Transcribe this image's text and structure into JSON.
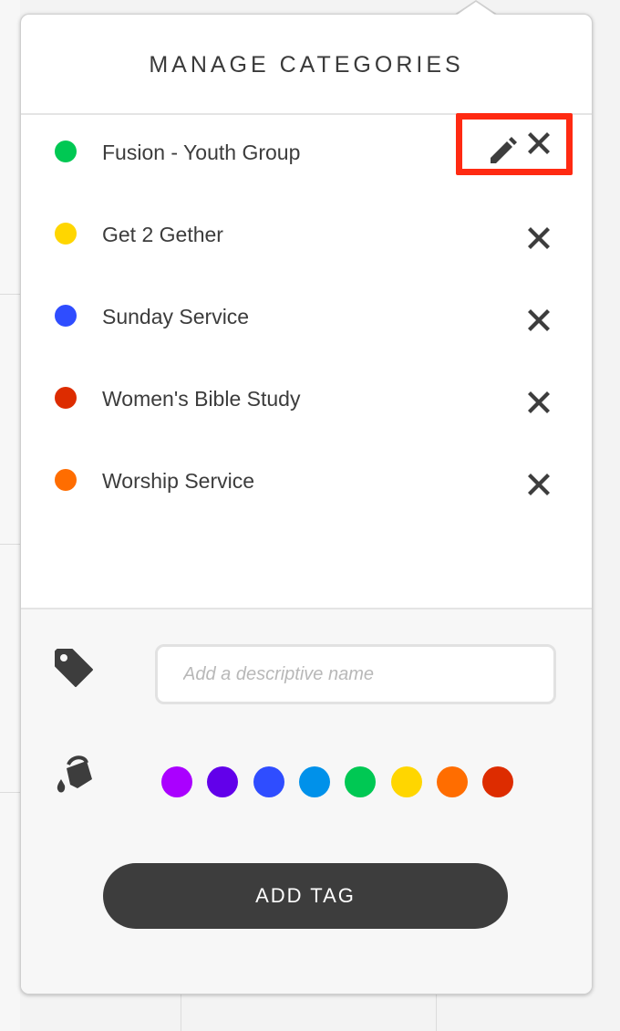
{
  "dialog": {
    "title": "MANAGE CATEGORIES"
  },
  "categories": [
    {
      "label": "Fusion - Youth Group",
      "color": "#00c853",
      "editable": true
    },
    {
      "label": "Get 2 Gether",
      "color": "#ffd600"
    },
    {
      "label": "Sunday Service",
      "color": "#2f4dff"
    },
    {
      "label": "Women's Bible Study",
      "color": "#dd2c00"
    },
    {
      "label": "Worship Service",
      "color": "#ff6d00"
    }
  ],
  "form": {
    "name_placeholder": "Add a descriptive name",
    "name_value": "",
    "swatch_colors": [
      "#aa00ff",
      "#6200ea",
      "#2f4dff",
      "#0091ea",
      "#00c853",
      "#ffd600",
      "#ff6d00",
      "#dd2c00"
    ],
    "submit_label": "ADD TAG"
  },
  "icons": {
    "tag": "tag-icon",
    "paint": "paint-bucket-icon",
    "edit": "pencil-icon",
    "delete": "close-icon"
  }
}
